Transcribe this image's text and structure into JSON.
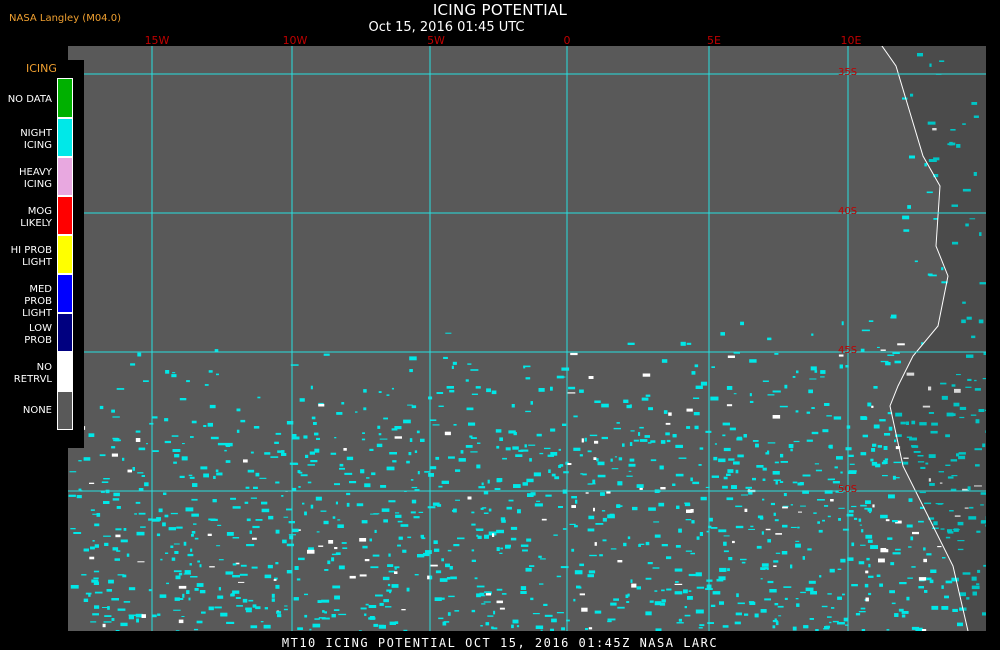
{
  "header": {
    "credit": "NASA Langley (M04.0)",
    "title": "ICING POTENTIAL",
    "subtitle": "Oct 15, 2016 01:45 UTC"
  },
  "footer": "MT10   ICING POTENTIAL   OCT 15, 2016 01:45Z   NASA LARC",
  "grid": {
    "line_color": "#28e0e0",
    "label_color": "#c00000",
    "longitudes": [
      "15W",
      "10W",
      "5W",
      "0",
      "5E",
      "10E"
    ],
    "latitudes": [
      "35S",
      "40S",
      "45S",
      "50S"
    ]
  },
  "legend": {
    "title": "ICING",
    "items": [
      {
        "label": "NO DATA",
        "color": "#00b000"
      },
      {
        "label": "NIGHT ICING",
        "color": "#00e8e8"
      },
      {
        "label": "HEAVY ICING",
        "color": "#e8a8e0"
      },
      {
        "label": "MOG LIKELY",
        "color": "#ff0000"
      },
      {
        "label": "HI PROB LIGHT",
        "color": "#ffff00"
      },
      {
        "label": "MED PROB LIGHT",
        "color": "#0000ff"
      },
      {
        "label": "LOW PROB",
        "color": "#000080"
      },
      {
        "label": "NO RETRVL",
        "color": "#ffffff"
      },
      {
        "label": "NONE",
        "color": "#595959"
      }
    ]
  },
  "colors": {
    "background": "#000000",
    "map_fill": "#595959",
    "coastline": "#ffffff",
    "night_icing": "#00e8e8",
    "no_retrieval": "#ffffff"
  }
}
